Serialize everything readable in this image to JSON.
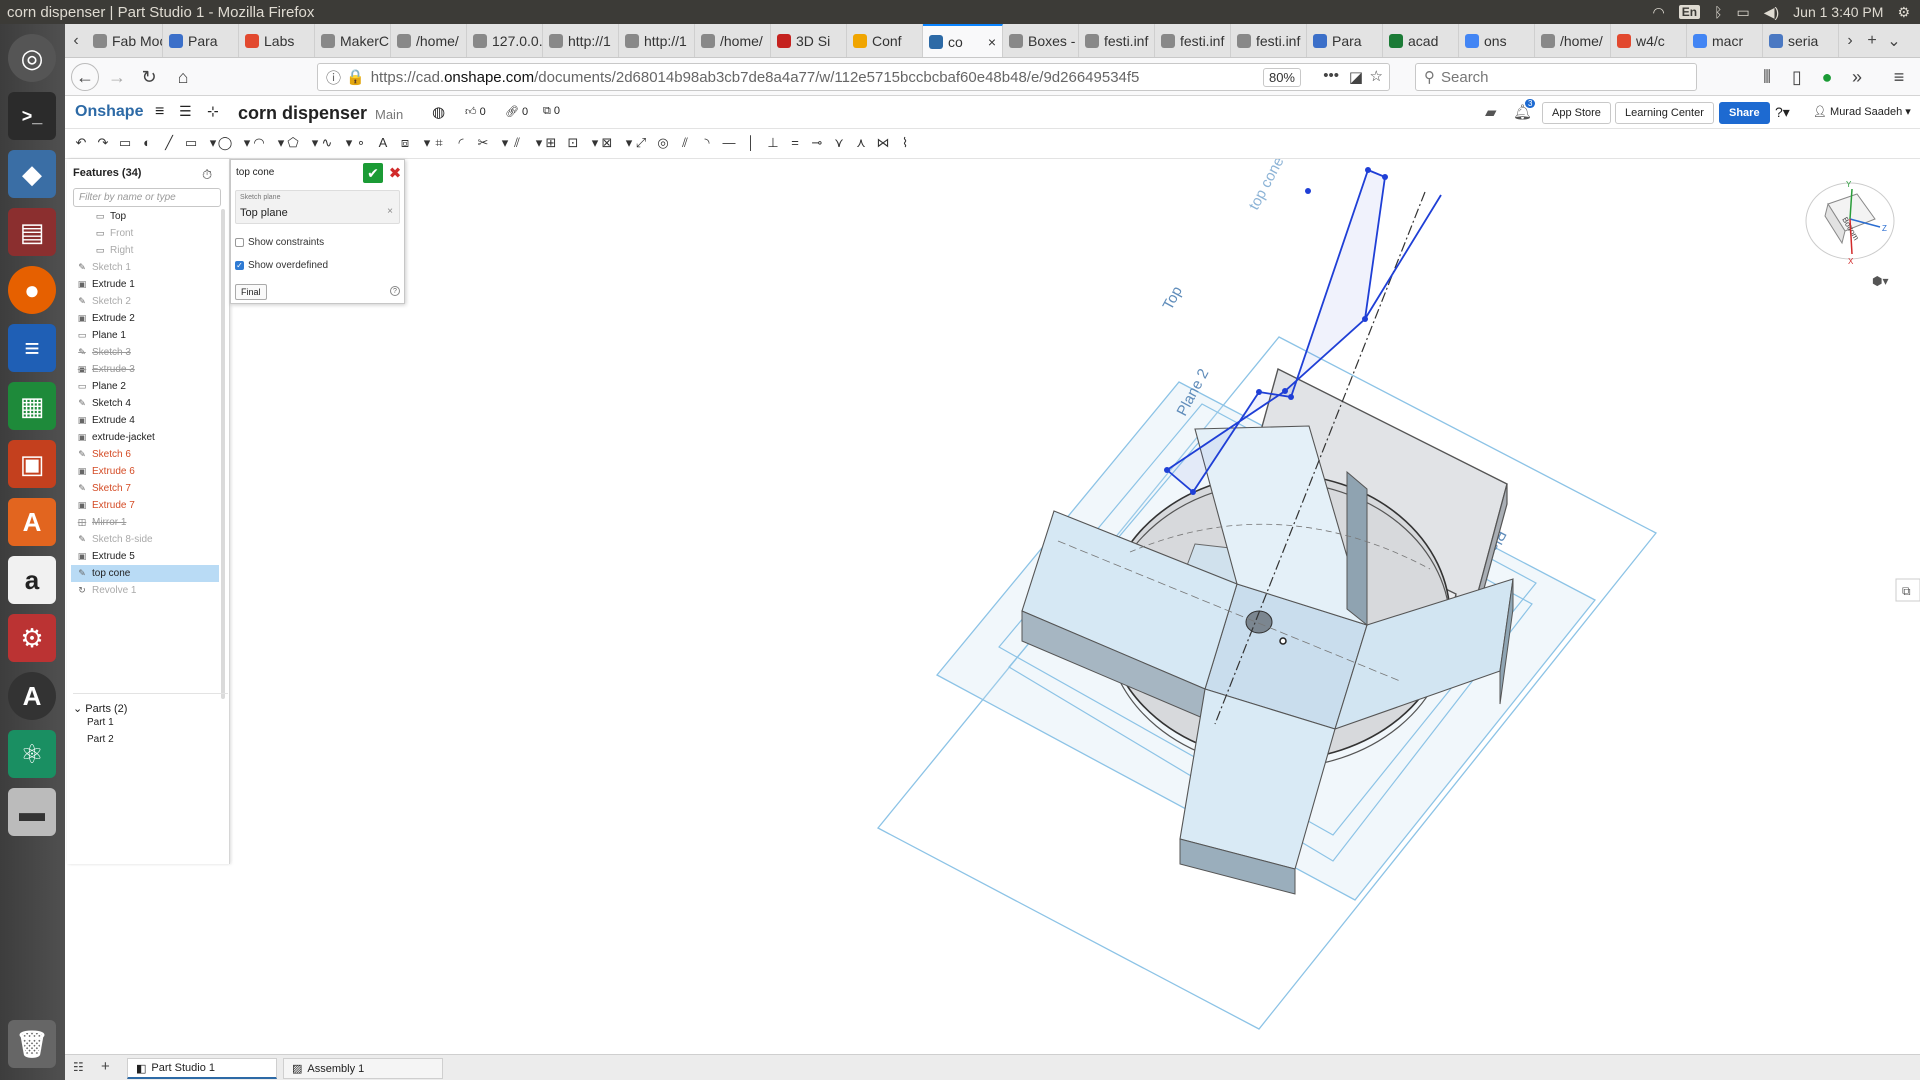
{
  "window": {
    "title": "corn dispenser | Part Studio 1 - Mozilla Firefox",
    "lang": "En",
    "datetime": "Jun 1  3:40 PM"
  },
  "browser": {
    "tabs": [
      {
        "label": "Fab Moc",
        "color": "#888"
      },
      {
        "label": "Para",
        "color": "#3b6fc9"
      },
      {
        "label": "Labs",
        "color": "#e2492f"
      },
      {
        "label": "MakerC",
        "color": "#888"
      },
      {
        "label": "/home/",
        "color": "#888"
      },
      {
        "label": "127.0.0.",
        "color": "#888"
      },
      {
        "label": "http://1",
        "color": "#888"
      },
      {
        "label": "http://1",
        "color": "#888"
      },
      {
        "label": "/home/",
        "color": "#888"
      },
      {
        "label": "3D Si",
        "color": "#c5221f"
      },
      {
        "label": "Conf",
        "color": "#f0a500"
      },
      {
        "label": "co",
        "color": "#2d6aa6",
        "active": true
      },
      {
        "label": "Boxes -",
        "color": "#888"
      },
      {
        "label": "festi.inf",
        "color": "#888"
      },
      {
        "label": "festi.inf",
        "color": "#888"
      },
      {
        "label": "festi.inf",
        "color": "#888"
      },
      {
        "label": "Para",
        "color": "#3b6fc9"
      },
      {
        "label": "acad",
        "color": "#1b7b36"
      },
      {
        "label": "ons",
        "color": "#4285f4"
      },
      {
        "label": "/home/",
        "color": "#888"
      },
      {
        "label": "w4/c",
        "color": "#e2492f"
      },
      {
        "label": "macr",
        "color": "#4285f4"
      },
      {
        "label": "seria",
        "color": "#4a78c2"
      }
    ],
    "url_prefix": "https://cad.",
    "url_host": "onshape.com",
    "url_rest": "/documents/2d68014b98ab3cb7de8a4a77/w/112e5715bccbcbaf60e48b48/e/9d26649534f5",
    "zoom": "80%",
    "search_placeholder": "Search"
  },
  "onshape": {
    "logo": "Onshape",
    "doc_title": "corn dispenser",
    "branch": "Main",
    "likes": "0",
    "links": "0",
    "copies": "0",
    "notif_count": "3",
    "app_store": "App Store",
    "learning_center": "Learning Center",
    "share": "Share",
    "user": "Murad Saadeh"
  },
  "features": {
    "title": "Features (34)",
    "filter_placeholder": "Filter by name or type",
    "items": [
      {
        "label": "Top",
        "kind": "plane",
        "state": "normal"
      },
      {
        "label": "Front",
        "kind": "plane",
        "state": "supp"
      },
      {
        "label": "Right",
        "kind": "plane",
        "state": "supp"
      },
      {
        "label": "Sketch 1",
        "kind": "sketch",
        "state": "supp"
      },
      {
        "label": "Extrude 1",
        "kind": "extrude",
        "state": "normal"
      },
      {
        "label": "Sketch 2",
        "kind": "sketch",
        "state": "supp"
      },
      {
        "label": "Extrude 2",
        "kind": "extrude",
        "state": "normal"
      },
      {
        "label": "Plane 1",
        "kind": "plane",
        "state": "normal"
      },
      {
        "label": "Sketch 3",
        "kind": "sketch",
        "state": "strike"
      },
      {
        "label": "Extrude 3",
        "kind": "extrude",
        "state": "strike"
      },
      {
        "label": "Plane 2",
        "kind": "plane",
        "state": "normal"
      },
      {
        "label": "Sketch 4",
        "kind": "sketch",
        "state": "normal"
      },
      {
        "label": "Extrude 4",
        "kind": "extrude",
        "state": "normal"
      },
      {
        "label": "extrude-jacket",
        "kind": "extrude",
        "state": "normal"
      },
      {
        "label": "Sketch 6",
        "kind": "sketch",
        "state": "err"
      },
      {
        "label": "Extrude 6",
        "kind": "extrude",
        "state": "err"
      },
      {
        "label": "Sketch 7",
        "kind": "sketch",
        "state": "err"
      },
      {
        "label": "Extrude 7",
        "kind": "extrude",
        "state": "err"
      },
      {
        "label": "Mirror 1",
        "kind": "mirror",
        "state": "strike"
      },
      {
        "label": "Sketch 8-side",
        "kind": "sketch",
        "state": "supp"
      },
      {
        "label": "Extrude 5",
        "kind": "extrude",
        "state": "normal"
      },
      {
        "label": "top cone",
        "kind": "sketch",
        "state": "sel"
      },
      {
        "label": "Revolve 1",
        "kind": "revolve",
        "state": "supp"
      }
    ],
    "parts_title": "Parts (2)",
    "parts": [
      "Part 1",
      "Part 2"
    ]
  },
  "dialog": {
    "name": "top cone",
    "plane_label": "Sketch plane",
    "plane_value": "Top plane",
    "show_constraints": "Show constraints",
    "show_overdefined": "Show overdefined",
    "final": "Final"
  },
  "viewport": {
    "plane_labels": [
      "top cone",
      "Top",
      "Plane 2",
      "Plane 1"
    ],
    "cube_face": "Bottom",
    "axes": [
      "Y",
      "Z",
      "X"
    ]
  },
  "bottom_tabs": [
    "Part Studio 1",
    "Assembly 1"
  ],
  "colors": {
    "accent": "#2d6aa6",
    "selection": "#b9dbf5",
    "error": "#d44b25",
    "sketch_blue": "#1f3fd6"
  }
}
